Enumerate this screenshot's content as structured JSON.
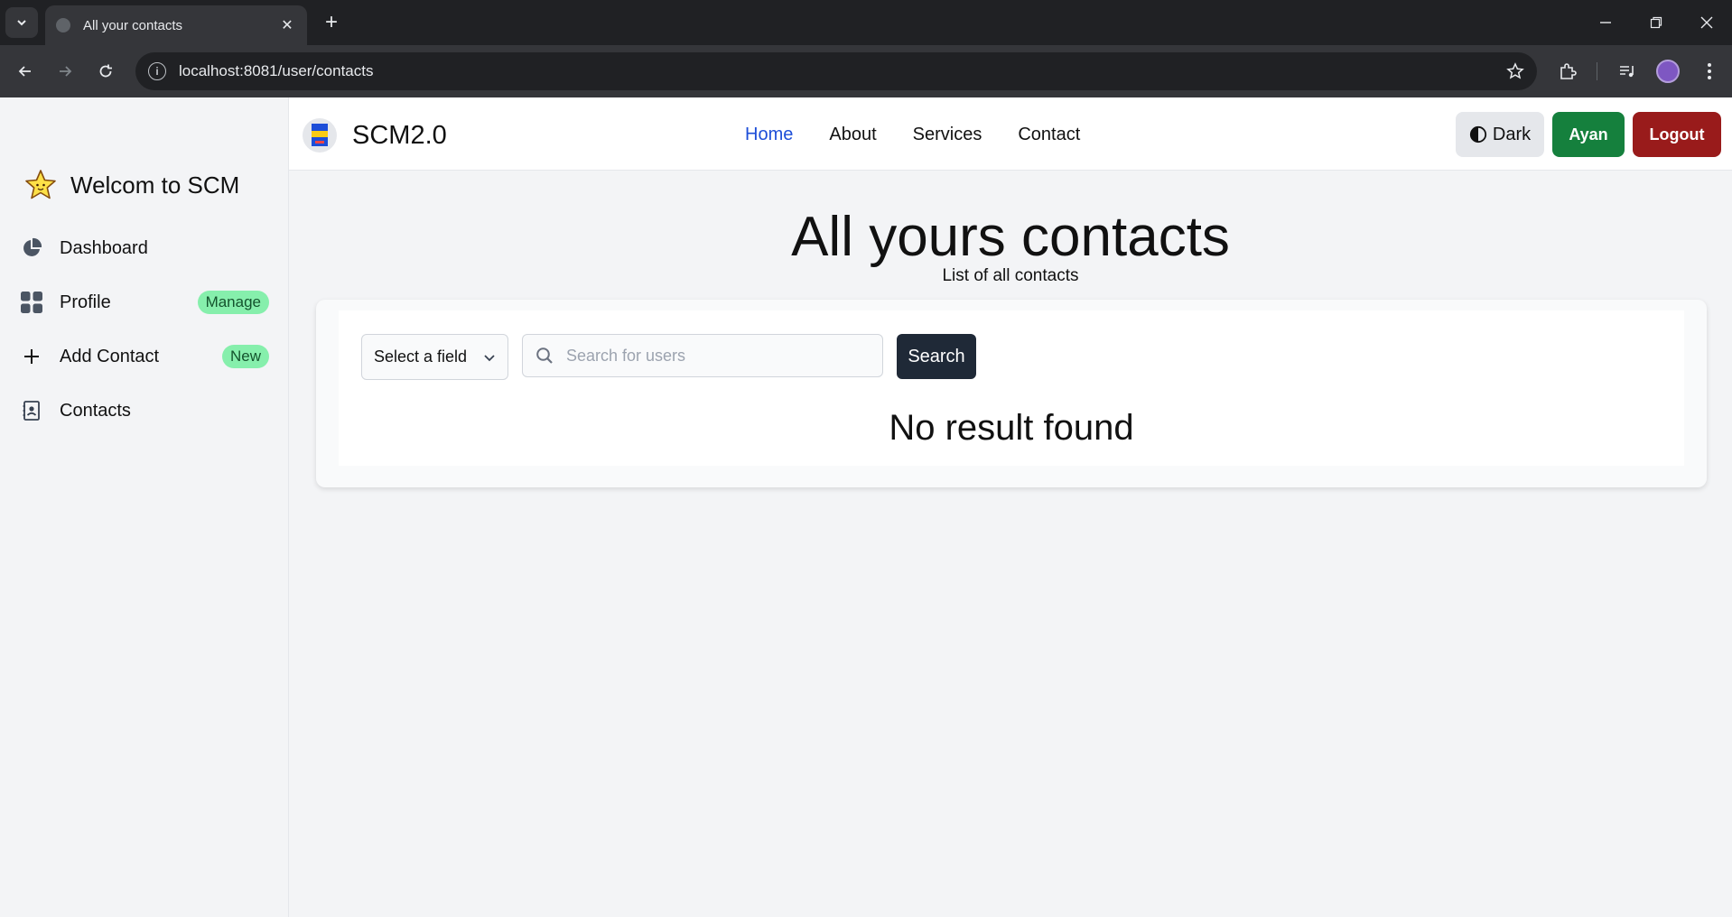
{
  "browser": {
    "tab_title": "All your contacts",
    "url": "localhost:8081/user/contacts"
  },
  "sidebar": {
    "brand": "Welcom to SCM",
    "items": [
      {
        "label": "Dashboard",
        "icon": "pie-chart-icon",
        "badge": ""
      },
      {
        "label": "Profile",
        "icon": "grid-icon",
        "badge": "Manage"
      },
      {
        "label": "Add Contact",
        "icon": "plus-icon",
        "badge": "New"
      },
      {
        "label": "Contacts",
        "icon": "contact-card-icon",
        "badge": ""
      }
    ]
  },
  "navbar": {
    "logo": "SCM2.0",
    "links": [
      "Home",
      "About",
      "Services",
      "Contact"
    ],
    "active_link": "Home",
    "dark_label": "Dark",
    "user_label": "Ayan",
    "logout_label": "Logout"
  },
  "main": {
    "title": "All yours contacts",
    "subtitle": "List of all contacts",
    "select_label": "Select a field",
    "search_placeholder": "Search for users",
    "search_button": "Search",
    "empty_message": "No result found"
  },
  "colors": {
    "active_link": "#1d4ed8",
    "user_button": "#15803d",
    "logout_button": "#991b1b",
    "search_button": "#1f2937",
    "badge": "#86efac"
  }
}
